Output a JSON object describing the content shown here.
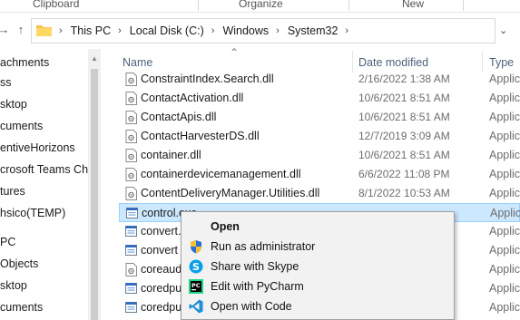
{
  "ribbon": {
    "groups": [
      "Clipboard",
      "Organize",
      "New"
    ]
  },
  "address": {
    "back_icon": "back-arrow-icon",
    "up_icon": "up-arrow-icon",
    "crumbs": [
      "This PC",
      "Local Disk (C:)",
      "Windows",
      "System32"
    ]
  },
  "nav": {
    "items": [
      "achments",
      "ss",
      "sktop",
      "cuments",
      "entiveHorizons",
      "crosoft Teams Chat",
      "tures",
      "hsico(TEMP)",
      "PC",
      "Objects",
      "sktop",
      "cuments"
    ]
  },
  "columns": {
    "name": "Name",
    "date": "Date modified",
    "type": "Type"
  },
  "files": [
    {
      "name": "ConstraintIndex.Search.dll",
      "date": "2/16/2022 1:38 AM",
      "type": "Applic",
      "icon": "dll-file-icon"
    },
    {
      "name": "ContactActivation.dll",
      "date": "10/6/2021 8:51 AM",
      "type": "Applic",
      "icon": "dll-file-icon"
    },
    {
      "name": "ContactApis.dll",
      "date": "10/6/2021 8:51 AM",
      "type": "Applic",
      "icon": "dll-file-icon"
    },
    {
      "name": "ContactHarvesterDS.dll",
      "date": "12/7/2019 3:09 AM",
      "type": "Applic",
      "icon": "dll-file-icon"
    },
    {
      "name": "container.dll",
      "date": "10/6/2021 8:51 AM",
      "type": "Applic",
      "icon": "dll-file-icon"
    },
    {
      "name": "containerdevicemanagement.dll",
      "date": "6/6/2022 11:08 PM",
      "type": "Applic",
      "icon": "dll-file-icon"
    },
    {
      "name": "ContentDeliveryManager.Utilities.dll",
      "date": "8/1/2022 10:53 AM",
      "type": "Applic",
      "icon": "dll-file-icon"
    },
    {
      "name": "control.exe",
      "date": "",
      "type": "Applic",
      "icon": "exe-file-icon",
      "selected": true
    },
    {
      "name": "convert.",
      "date": "",
      "type": "Applic",
      "icon": "exe-file-icon"
    },
    {
      "name": "convert",
      "date": "",
      "type": "Applic",
      "icon": "exe-file-icon"
    },
    {
      "name": "coreaud",
      "date": "",
      "type": "Applic",
      "icon": "dll-file-icon"
    },
    {
      "name": "coredpu",
      "date": "",
      "type": "Applic",
      "icon": "exe-file-icon"
    },
    {
      "name": "coredpu",
      "date": "",
      "type": "Applic",
      "icon": "exe-file-icon"
    }
  ],
  "context_menu": {
    "items": [
      {
        "label": "Open",
        "icon": "",
        "bold": true
      },
      {
        "label": "Run as administrator",
        "icon": "uac-shield-icon"
      },
      {
        "label": "Share with Skype",
        "icon": "skype-icon"
      },
      {
        "label": "Edit with PyCharm",
        "icon": "pycharm-icon"
      },
      {
        "label": "Open with Code",
        "icon": "vscode-icon"
      }
    ]
  },
  "colors": {
    "selection_bg": "#cce8ff",
    "selection_border": "#99d1ff",
    "header_text": "#4c607a",
    "menu_bg": "#f2f2f2"
  }
}
